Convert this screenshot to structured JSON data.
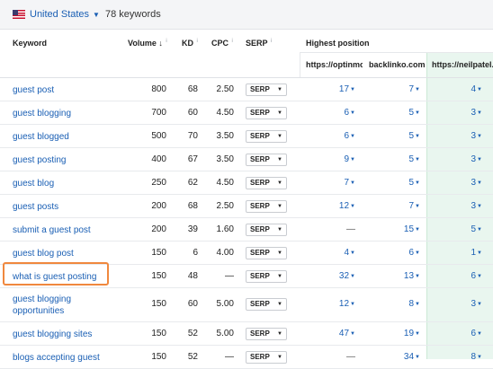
{
  "topbar": {
    "country": "United States",
    "keyword_count": "78 keywords"
  },
  "columns": {
    "keyword": "Keyword",
    "volume": "Volume",
    "volume_sort_icon": "↓",
    "kd": "KD",
    "cpc": "CPC",
    "serp": "SERP",
    "highest_position": "Highest position",
    "info_icon": "i"
  },
  "competitors": [
    "https://optinmonster.com",
    "backlinko.com",
    "https://neilpatel.com"
  ],
  "serp_button_label": "SERP",
  "rows": [
    {
      "keyword": "guest post",
      "volume": "800",
      "kd": "68",
      "cpc": "2.50",
      "p1": "17",
      "p2": "7",
      "p3": "4"
    },
    {
      "keyword": "guest blogging",
      "volume": "700",
      "kd": "60",
      "cpc": "4.50",
      "p1": "6",
      "p2": "5",
      "p3": "3"
    },
    {
      "keyword": "guest blogged",
      "volume": "500",
      "kd": "70",
      "cpc": "3.50",
      "p1": "6",
      "p2": "5",
      "p3": "3"
    },
    {
      "keyword": "guest posting",
      "volume": "400",
      "kd": "67",
      "cpc": "3.50",
      "p1": "9",
      "p2": "5",
      "p3": "3"
    },
    {
      "keyword": "guest blog",
      "volume": "250",
      "kd": "62",
      "cpc": "4.50",
      "p1": "7",
      "p2": "5",
      "p3": "3"
    },
    {
      "keyword": "guest posts",
      "volume": "200",
      "kd": "68",
      "cpc": "2.50",
      "p1": "12",
      "p2": "7",
      "p3": "3"
    },
    {
      "keyword": "submit a guest post",
      "volume": "200",
      "kd": "39",
      "cpc": "1.60",
      "p1": "—",
      "p2": "15",
      "p3": "5"
    },
    {
      "keyword": "guest blog post",
      "volume": "150",
      "kd": "6",
      "cpc": "4.00",
      "p1": "4",
      "p2": "6",
      "p3": "1"
    },
    {
      "keyword": "what is guest posting",
      "volume": "150",
      "kd": "48",
      "cpc": "—",
      "p1": "32",
      "p2": "13",
      "p3": "6"
    },
    {
      "keyword": "guest blogging opportunities",
      "volume": "150",
      "kd": "60",
      "cpc": "5.00",
      "p1": "12",
      "p2": "8",
      "p3": "3"
    },
    {
      "keyword": "guest blogging sites",
      "volume": "150",
      "kd": "52",
      "cpc": "5.00",
      "p1": "47",
      "p2": "19",
      "p3": "6"
    },
    {
      "keyword": "blogs accepting guest",
      "volume": "150",
      "kd": "52",
      "cpc": "—",
      "p1": "—",
      "p2": "34",
      "p3": "8"
    }
  ],
  "colors": {
    "link": "#1a5fb4",
    "highlight": "#f0883e",
    "highlighted_column_bg": "#e9f6ef"
  }
}
